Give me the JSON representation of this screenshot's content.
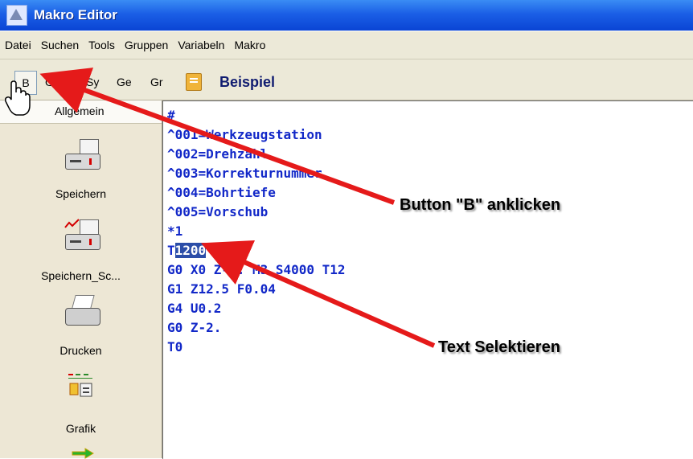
{
  "window": {
    "title": "Makro Editor"
  },
  "menu": {
    "items": [
      "Datei",
      "Suchen",
      "Tools",
      "Gruppen",
      "Variabeln",
      "Makro"
    ]
  },
  "toolbar": {
    "b_button": "B",
    "buttons": [
      "Gl",
      "Sy",
      "Ge",
      "Gr"
    ],
    "group_label": "Beispiel"
  },
  "sidebar": {
    "header": "Allgemein",
    "items": [
      "Speichern",
      "Speichern_Sc...",
      "Drucken",
      "Grafik"
    ]
  },
  "editor": {
    "lines": [
      "#",
      "^001=Werkzeugstation",
      "^002=Drehzahl",
      "^003=Korrekturnummer",
      "^004=Bohrtiefe",
      "^005=Vorschub",
      "*1",
      "T",
      "G0 X0 Z-1. M3 S4000 T12",
      "G1 Z12.5 F0.04",
      "G4 U0.2",
      "G0 Z-2.",
      "T0"
    ],
    "selected_text": "1200"
  },
  "annotations": {
    "button_hint": "Button \"B\" anklicken",
    "select_hint": "Text Selektieren"
  },
  "colors": {
    "titlebar": "#1b5fe6",
    "code_text": "#1228c8",
    "selection": "#2c4ea8",
    "arrow": "#e51a1a"
  }
}
